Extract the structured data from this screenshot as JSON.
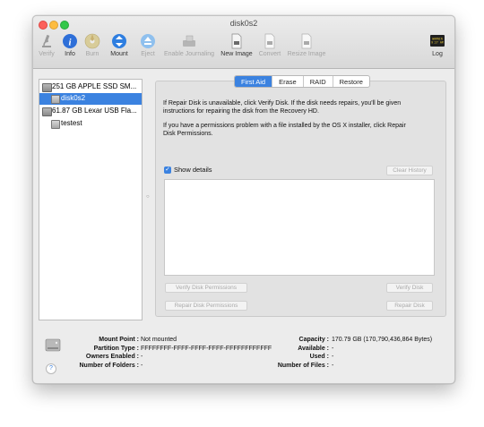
{
  "window": {
    "title": "disk0s2"
  },
  "toolbar": {
    "items": [
      {
        "label": "Verify",
        "icon": "microscope-icon",
        "enabled": false
      },
      {
        "label": "Info",
        "icon": "info-icon",
        "enabled": true
      },
      {
        "label": "Burn",
        "icon": "burn-disc-icon",
        "enabled": false
      },
      {
        "label": "Mount",
        "icon": "mount-icon",
        "enabled": true
      },
      {
        "label": "Eject",
        "icon": "eject-icon",
        "enabled": false
      },
      {
        "label": "Enable Journaling",
        "icon": "journal-drive-icon",
        "enabled": false
      },
      {
        "label": "New Image",
        "icon": "new-image-icon",
        "enabled": true
      },
      {
        "label": "Convert",
        "icon": "convert-image-icon",
        "enabled": false
      },
      {
        "label": "Resize Image",
        "icon": "resize-image-icon",
        "enabled": false
      }
    ],
    "log": {
      "label": "Log",
      "icon_text": "WARNIN\n9:27 AM"
    }
  },
  "sidebar": {
    "items": [
      {
        "label": "251 GB APPLE SSD SM...",
        "kind": "disk",
        "selected": false
      },
      {
        "label": "disk0s2",
        "kind": "volume",
        "selected": true
      },
      {
        "label": "61.87 GB Lexar USB Fla...",
        "kind": "disk",
        "selected": false
      },
      {
        "label": "testest",
        "kind": "volume",
        "selected": false
      }
    ]
  },
  "tabs": [
    "First Aid",
    "Erase",
    "RAID",
    "Restore"
  ],
  "active_tab": "First Aid",
  "first_aid": {
    "para1_line1": "If Repair Disk is unavailable, click Verify Disk. If the disk needs repairs, you'll be given",
    "para1_line2": "instructions for repairing the disk from the Recovery HD.",
    "para2_line1": "If you have a permissions problem with a file installed by the OS X installer, click Repair",
    "para2_line2": "Disk Permissions.",
    "show_details_label": "Show details",
    "show_details_checked": true,
    "clear_history": "Clear History",
    "verify_permissions": "Verify Disk Permissions",
    "repair_permissions": "Repair Disk Permissions",
    "verify_disk": "Verify Disk",
    "repair_disk": "Repair Disk"
  },
  "info": {
    "mount_point_label": "Mount Point :",
    "mount_point_value": "Not mounted",
    "partition_type_label": "Partition Type :",
    "partition_type_value": "FFFFFFFF-FFFF-FFFF-FFFF-FFFFFFFFFFFF",
    "owners_enabled_label": "Owners Enabled :",
    "owners_enabled_value": "-",
    "folders_label": "Number of Folders :",
    "folders_value": "-",
    "capacity_label": "Capacity :",
    "capacity_value": "170.79 GB (170,790,436,864 Bytes)",
    "available_label": "Available :",
    "available_value": "-",
    "used_label": "Used :",
    "used_value": "-",
    "files_label": "Number of Files :",
    "files_value": "-",
    "help": "?"
  },
  "colors": {
    "accent": "#3b82e0",
    "disabled_text": "#a9a9a9"
  }
}
